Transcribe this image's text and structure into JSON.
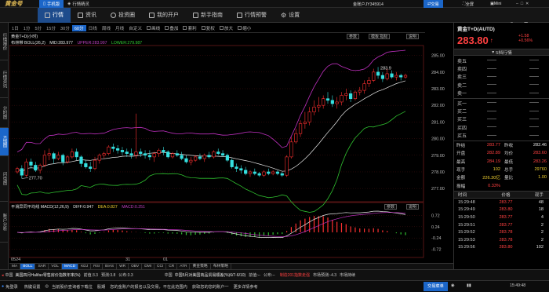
{
  "titlebar": {
    "logo": "黄金号",
    "tabs": [
      {
        "label": "手机版",
        "active": true
      },
      {
        "label": "行情精灵",
        "active": false
      }
    ],
    "account": "金账户JY345914",
    "trade": "交易",
    "fullscreen": "全屏",
    "mini": "Mini"
  },
  "nav": {
    "items": [
      {
        "label": "行情",
        "active": true
      },
      {
        "label": "资讯",
        "active": false
      },
      {
        "label": "投资圈",
        "active": false
      },
      {
        "label": "我的开户",
        "active": false
      },
      {
        "label": "新手指南",
        "active": false
      },
      {
        "label": "行情预警",
        "active": false
      },
      {
        "label": "设置",
        "active": false
      }
    ]
  },
  "leftbar": {
    "tabs": [
      {
        "label": "行情报价",
        "active": false
      },
      {
        "label": "行情资讯",
        "active": false
      },
      {
        "label": "分时图",
        "active": false
      },
      {
        "label": "K线图",
        "active": true
      },
      {
        "label": "闪电图",
        "active": false
      },
      {
        "label": "账户分析",
        "active": false
      }
    ]
  },
  "periodbar": {
    "items": [
      {
        "label": "1日",
        "active": false
      },
      {
        "label": "1分",
        "active": false
      },
      {
        "label": "5分",
        "active": false
      },
      {
        "label": "15分",
        "active": false
      },
      {
        "label": "30分",
        "active": false
      },
      {
        "label": "60分",
        "active": true
      },
      {
        "label": "日线",
        "active": false
      },
      {
        "label": "周线",
        "active": false
      },
      {
        "label": "月线",
        "active": false
      },
      {
        "label": "自定义",
        "active": false
      }
    ],
    "tools": [
      "画线",
      "叠加",
      "套利",
      "复权",
      "放大",
      "缩小"
    ]
  },
  "main_chart": {
    "instrument": "黄金T+D(小时)",
    "indicator": "布林带 BOLL(26,2)",
    "mid": "MID:283.977",
    "upper": "UPPER:283.997",
    "lower": "LOWER:279.987",
    "buttons": [
      "参数",
      "模板 指标",
      "说明"
    ]
  },
  "sub_chart": {
    "indicator": "平滑异同平均线 MACD(12,26,9)",
    "diff": "DIFF:0.947",
    "dea": "DEA:0.827",
    "macd": "MACD:0.251",
    "buttons": [
      "参数",
      "说明"
    ]
  },
  "chart_data": {
    "type": "candlestick",
    "price_axis": [
      285,
      284,
      283,
      282,
      281,
      280,
      279,
      278,
      277
    ],
    "ylim": [
      276.3,
      285.5
    ],
    "x_labels": [
      "0524",
      "31",
      "01"
    ],
    "candles": [
      [
        278.0,
        278.3,
        277.9,
        278.2
      ],
      [
        278.2,
        278.4,
        277.6,
        277.8
      ],
      [
        277.8,
        278.8,
        277.7,
        278.6
      ],
      [
        278.6,
        278.8,
        278.2,
        278.4
      ],
      [
        278.4,
        278.6,
        278.0,
        278.1
      ],
      [
        278.1,
        278.5,
        277.9,
        278.4
      ],
      [
        278.4,
        279.3,
        278.3,
        279.0
      ],
      [
        279.0,
        279.4,
        278.7,
        279.1
      ],
      [
        279.1,
        279.2,
        278.5,
        278.8
      ],
      [
        278.8,
        279.2,
        278.7,
        279.0
      ],
      [
        279.0,
        279.1,
        278.4,
        278.6
      ],
      [
        278.6,
        279.0,
        278.5,
        278.9
      ],
      [
        278.9,
        279.4,
        278.8,
        279.2
      ],
      [
        279.2,
        279.4,
        278.7,
        278.9
      ],
      [
        278.9,
        279.0,
        278.3,
        278.5
      ],
      [
        278.5,
        278.7,
        278.2,
        278.3
      ],
      [
        278.3,
        278.6,
        278.0,
        278.2
      ],
      [
        278.2,
        278.9,
        278.1,
        278.7
      ],
      [
        278.7,
        279.1,
        278.5,
        279.0
      ],
      [
        279.0,
        279.2,
        278.8,
        279.1
      ],
      [
        279.1,
        279.6,
        279.0,
        279.5
      ],
      [
        279.5,
        279.7,
        279.2,
        279.4
      ],
      [
        279.4,
        279.6,
        279.1,
        279.3
      ],
      [
        279.3,
        279.5,
        279.0,
        279.2
      ],
      [
        279.2,
        279.4,
        278.9,
        279.1
      ],
      [
        279.1,
        279.4,
        278.8,
        279.0
      ],
      [
        279.0,
        281.5,
        278.8,
        279.2
      ],
      [
        279.2,
        279.4,
        278.9,
        279.1
      ],
      [
        279.1,
        279.3,
        278.8,
        279.0
      ],
      [
        279.0,
        279.3,
        278.7,
        278.9
      ],
      [
        278.9,
        279.2,
        278.6,
        279.1
      ],
      [
        279.1,
        279.4,
        278.9,
        279.3
      ],
      [
        279.3,
        279.5,
        279.0,
        279.2
      ],
      [
        279.2,
        279.3,
        278.8,
        278.9
      ],
      [
        278.9,
        279.2,
        278.8,
        279.1
      ],
      [
        279.1,
        279.3,
        278.9,
        279.0
      ],
      [
        279.0,
        279.2,
        278.7,
        278.8
      ],
      [
        278.8,
        279.0,
        278.5,
        278.6
      ],
      [
        278.6,
        278.9,
        278.4,
        278.7
      ],
      [
        278.7,
        279.0,
        278.6,
        278.9
      ],
      [
        278.9,
        279.1,
        278.7,
        278.8
      ],
      [
        278.8,
        279.1,
        278.6,
        279.0
      ],
      [
        279.0,
        279.2,
        278.8,
        278.9
      ],
      [
        278.9,
        279.3,
        278.8,
        279.2
      ],
      [
        279.2,
        279.4,
        279.0,
        279.1
      ],
      [
        279.1,
        279.3,
        278.9,
        279.0
      ],
      [
        279.0,
        279.1,
        278.6,
        278.7
      ],
      [
        278.7,
        278.8,
        278.2,
        278.3
      ],
      [
        278.3,
        278.5,
        278.0,
        278.2
      ],
      [
        278.2,
        278.4,
        277.9,
        278.1
      ],
      [
        278.1,
        278.3,
        277.8,
        277.9
      ],
      [
        277.9,
        278.1,
        277.7,
        278.0
      ],
      [
        278.0,
        278.2,
        277.8,
        277.9
      ],
      [
        277.9,
        278.0,
        277.7,
        277.8
      ],
      [
        277.8,
        278.1,
        277.7,
        278.0
      ],
      [
        278.0,
        278.2,
        277.8,
        277.9
      ],
      [
        277.9,
        278.1,
        277.8,
        278.0
      ],
      [
        278.0,
        278.1,
        277.8,
        277.9
      ],
      [
        277.9,
        278.0,
        277.7,
        277.8
      ],
      [
        277.8,
        279.0,
        277.7,
        278.9
      ],
      [
        278.9,
        280.1,
        278.8,
        279.8
      ],
      [
        279.8,
        280.6,
        279.7,
        280.3
      ],
      [
        280.3,
        281.1,
        280.1,
        280.9
      ],
      [
        280.9,
        281.6,
        280.6,
        281.0
      ],
      [
        281.0,
        281.9,
        280.8,
        281.6
      ],
      [
        281.6,
        282.3,
        281.4,
        281.9
      ],
      [
        281.9,
        282.5,
        281.6,
        282.0
      ],
      [
        282.0,
        282.6,
        281.8,
        282.4
      ],
      [
        282.4,
        282.8,
        282.1,
        282.3
      ],
      [
        282.3,
        282.6,
        281.9,
        282.1
      ],
      [
        282.1,
        282.5,
        281.8,
        282.2
      ],
      [
        282.2,
        282.8,
        282.0,
        282.6
      ],
      [
        282.6,
        283.0,
        282.3,
        282.7
      ],
      [
        282.7,
        282.9,
        282.2,
        282.4
      ],
      [
        282.4,
        282.9,
        282.3,
        282.8
      ],
      [
        282.8,
        283.1,
        282.6,
        282.9
      ],
      [
        282.9,
        283.5,
        282.7,
        283.3
      ],
      [
        283.3,
        283.7,
        283.1,
        283.5
      ],
      [
        283.5,
        284.2,
        283.4,
        284.0
      ],
      [
        284.0,
        284.3,
        283.6,
        283.8
      ],
      [
        283.8,
        284.0,
        283.4,
        283.6
      ],
      [
        283.6,
        284.2,
        283.5,
        283.9
      ],
      [
        283.9,
        284.1,
        283.6,
        283.7
      ],
      [
        283.7,
        284.0,
        283.5,
        283.8
      ],
      [
        283.8,
        283.9,
        283.5,
        283.7
      ],
      [
        283.7,
        283.9,
        283.6,
        283.8
      ]
    ],
    "high_label": "283.9",
    "low_label": "277.70",
    "macd_axis": [
      0.72,
      0.24,
      -0.24,
      -0.72
    ],
    "macd_ylim": [
      -1.0,
      1.0
    ]
  },
  "quote": {
    "title": "黄金T+D(AUTD)",
    "price": "283.80",
    "arrow": "↑",
    "change": "+1.58",
    "pct": "+0.56%",
    "depth_button": "5档行情",
    "asks": [
      {
        "label": "卖五",
        "price": "——",
        "qty": "——"
      },
      {
        "label": "卖四",
        "price": "——",
        "qty": "——"
      },
      {
        "label": "卖三",
        "price": "——",
        "qty": "——"
      },
      {
        "label": "卖二",
        "price": "——",
        "qty": "——"
      },
      {
        "label": "卖一",
        "price": "——",
        "qty": "——"
      }
    ],
    "bids": [
      {
        "label": "买一",
        "price": "——",
        "qty": "——"
      },
      {
        "label": "买二",
        "price": "——",
        "qty": "——"
      },
      {
        "label": "买三",
        "price": "——",
        "qty": "——"
      },
      {
        "label": "买四",
        "price": "——",
        "qty": "——"
      },
      {
        "label": "买五",
        "price": "——",
        "qty": "——"
      }
    ],
    "stats": [
      [
        "昨结",
        "283.77",
        "昨收",
        "282.46"
      ],
      [
        "开盘",
        "282.89",
        "均价",
        "283.60"
      ],
      [
        "最高",
        "284.19",
        "最低",
        "283.26"
      ],
      [
        "现手",
        "102",
        "总手",
        "29760"
      ],
      [
        "金额",
        "226.30亿",
        "量比",
        "1.00"
      ],
      [
        "振幅",
        "0.33%",
        "",
        ""
      ]
    ],
    "ticks_header": [
      "时间",
      "价格",
      "现手"
    ],
    "ticks": [
      [
        "15:29:48",
        "283.77",
        "48"
      ],
      [
        "15:29:49",
        "283.80",
        "18"
      ],
      [
        "15:29:50",
        "283.77",
        "4"
      ],
      [
        "15:29:51",
        "283.77",
        "2"
      ],
      [
        "15:29:52",
        "283.78",
        "2"
      ],
      [
        "15:29:53",
        "283.78",
        "2"
      ],
      [
        "15:29:56",
        "283.80",
        "102"
      ]
    ]
  },
  "indicator_tabs": [
    "MA",
    "BOLL",
    "SAR",
    "VOL",
    "MACD",
    "KDJ",
    "RSI",
    "BIAS",
    "WR",
    "OBV",
    "DMI",
    "CCI",
    "CR",
    "ATR",
    "黄金策略",
    "布林策略"
  ],
  "bottom_bar": {
    "segments": [
      "中国",
      "美国四月Halifax零售房价指数年率(%)",
      "前值:3.3",
      "预测:3.8",
      "公布:3.3",
      "中国",
      "中国5月对美国商品贸易顺差(%)6/7-6/10)",
      "前值:--",
      "公布:--"
    ],
    "trend": "制造201指数走强",
    "timeframe": "市场预测:-4.3",
    "right": "市场持续"
  },
  "status_bar": {
    "left": "免登录",
    "items": [
      "热键设置",
      "◎",
      "当前股价查询者下载位",
      "股期",
      "您的金账户的报名以及交易，不在此范围内",
      "获取您的您的账户一",
      "更多详情参考"
    ],
    "trade": "交易菜单",
    "time": "15:49:48"
  }
}
